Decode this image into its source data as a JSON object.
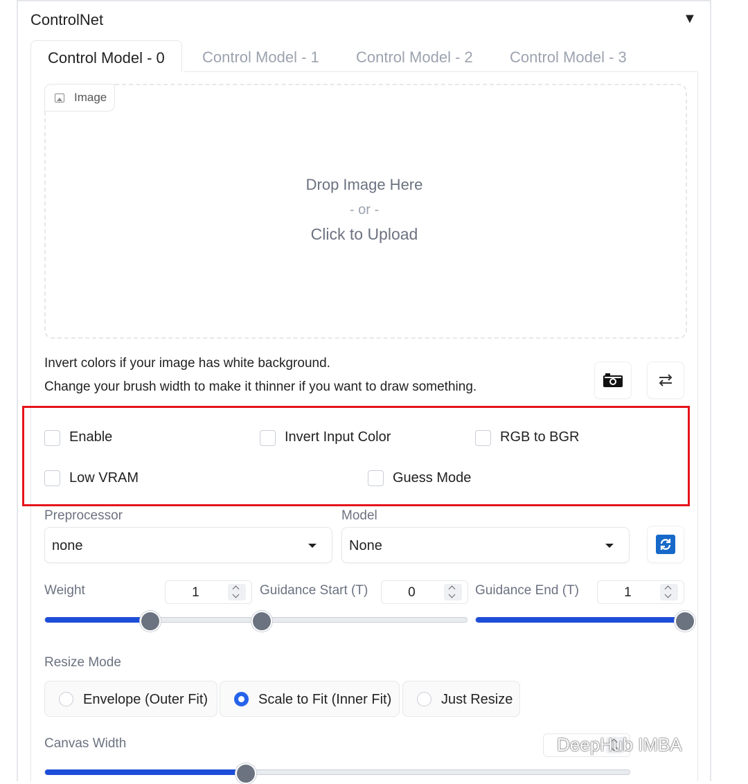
{
  "panel": {
    "title": "ControlNet",
    "collapse_icon": "triangle-down-icon"
  },
  "tabs": [
    {
      "label": "Control Model - 0",
      "active": true
    },
    {
      "label": "Control Model - 1",
      "active": false
    },
    {
      "label": "Control Model - 2",
      "active": false
    },
    {
      "label": "Control Model - 3",
      "active": false
    }
  ],
  "upload": {
    "badge": "Image",
    "line1": "Drop Image Here",
    "line2": "- or -",
    "line3": "Click to Upload"
  },
  "hints": [
    "Invert colors if your image has white background.",
    "Change your brush width to make it thinner if you want to draw something."
  ],
  "tools": {
    "camera": "camera-icon",
    "swap": "swap-arrows-icon"
  },
  "checkboxes": {
    "enable": {
      "label": "Enable",
      "checked": false
    },
    "invert": {
      "label": "Invert Input Color",
      "checked": false
    },
    "rgb_bgr": {
      "label": "RGB to BGR",
      "checked": false
    },
    "low_vram": {
      "label": "Low VRAM",
      "checked": false
    },
    "guess_mode": {
      "label": "Guess Mode",
      "checked": false
    }
  },
  "preprocessor": {
    "label": "Preprocessor",
    "value": "none"
  },
  "model": {
    "label": "Model",
    "value": "None",
    "refresh_icon": "refresh-icon"
  },
  "weight": {
    "label": "Weight",
    "value": "1",
    "fraction": 0.5
  },
  "guidance_start": {
    "label": "Guidance Start (T)",
    "value": "0",
    "fraction": 0.0
  },
  "guidance_end": {
    "label": "Guidance End (T)",
    "value": "1",
    "fraction": 1.0
  },
  "resize_mode": {
    "label": "Resize Mode",
    "options": [
      "Envelope (Outer Fit)",
      "Scale to Fit (Inner Fit)",
      "Just Resize"
    ],
    "selected": "Scale to Fit (Inner Fit)"
  },
  "canvas_width": {
    "label": "Canvas Width",
    "fraction": 0.34
  },
  "watermark": "DeepHub IMBA",
  "colors": {
    "accent": "#2563eb",
    "highlight_box": "#e5141b"
  }
}
